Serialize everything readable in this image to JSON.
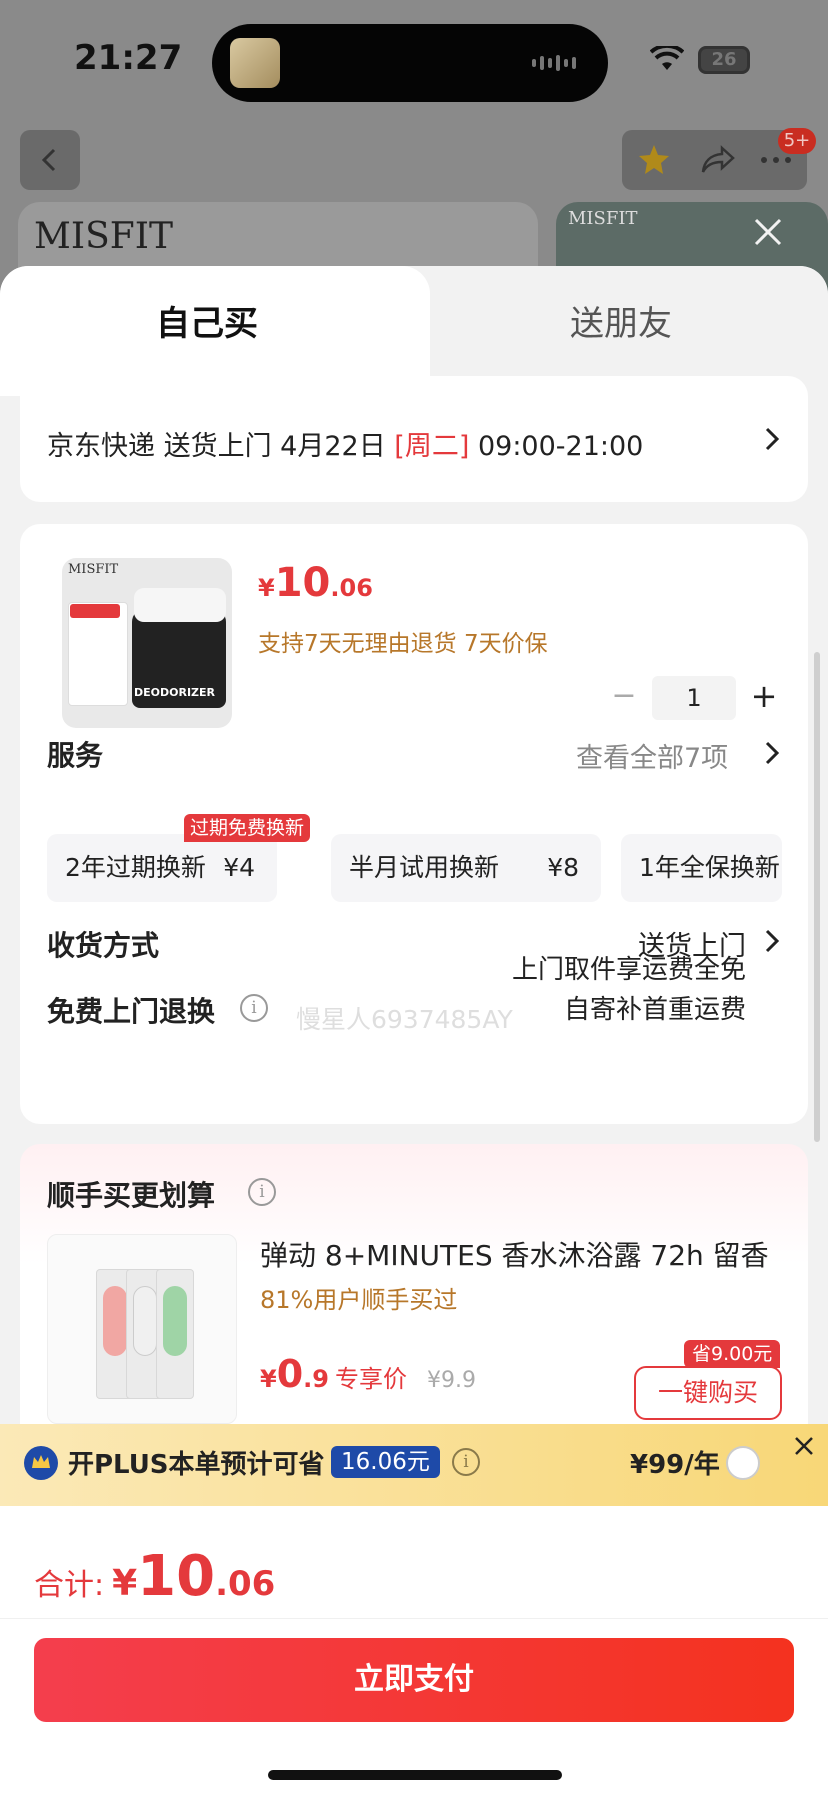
{
  "status_bar": {
    "time": "21:27",
    "battery": "26"
  },
  "background": {
    "brand_left": "MISFIT",
    "brand_right": "MISFIT",
    "cart_badge": "5+"
  },
  "tabs": {
    "self": "自己买",
    "friend": "送朋友"
  },
  "delivery": {
    "prefix": "京东快递 送货上门 4月22日 ",
    "weekday": "[周二]",
    "time": " 09:00-21:00"
  },
  "product": {
    "image_brand": "MISFIT",
    "image_label": "DEODORIZER",
    "price_symbol": "¥",
    "price_int": "10",
    "price_dec": ".06",
    "return_policy": "支持7天无理由退货  7天价保",
    "quantity": "1",
    "minus": "−",
    "plus": "+"
  },
  "services": {
    "label": "服务",
    "view_all": "查看全部7项",
    "badge": "过期免费换新",
    "watermark": "慢星人6937485AY",
    "items": [
      {
        "name": "2年过期换新",
        "price": "¥4"
      },
      {
        "name": "半月试用换新",
        "price": "¥8"
      },
      {
        "name": "1年全保换新",
        "price": ""
      }
    ]
  },
  "shipping": {
    "label": "收货方式",
    "value": "送货上门"
  },
  "free_return": {
    "label": "免费上门退换",
    "line1": "上门取件享运费全免",
    "line2": "自寄补首重运费"
  },
  "recommend": {
    "title": "顺手买更划算",
    "name": "弹动 8+MINUTES 香水沐浴露 72h 留香",
    "sub": "81%用户顺手买过",
    "price_yen": "¥",
    "price_int": "0",
    "price_dec": ".9",
    "price_label": "专享价",
    "original": "¥9.9",
    "save_tag": "省9.00元",
    "buy": "一键购买"
  },
  "plus_banner": {
    "text": "开PLUS本单预计可省",
    "amount": "16.06元",
    "price": "¥99/年"
  },
  "footer": {
    "total_label": "合计:",
    "yen": "¥",
    "total_int": "10",
    "total_dec": ".06",
    "pay": "立即支付"
  },
  "colors": {
    "accent": "#e4393c",
    "gold_text": "#b7772a",
    "plus_blue": "#1e4aa8"
  }
}
